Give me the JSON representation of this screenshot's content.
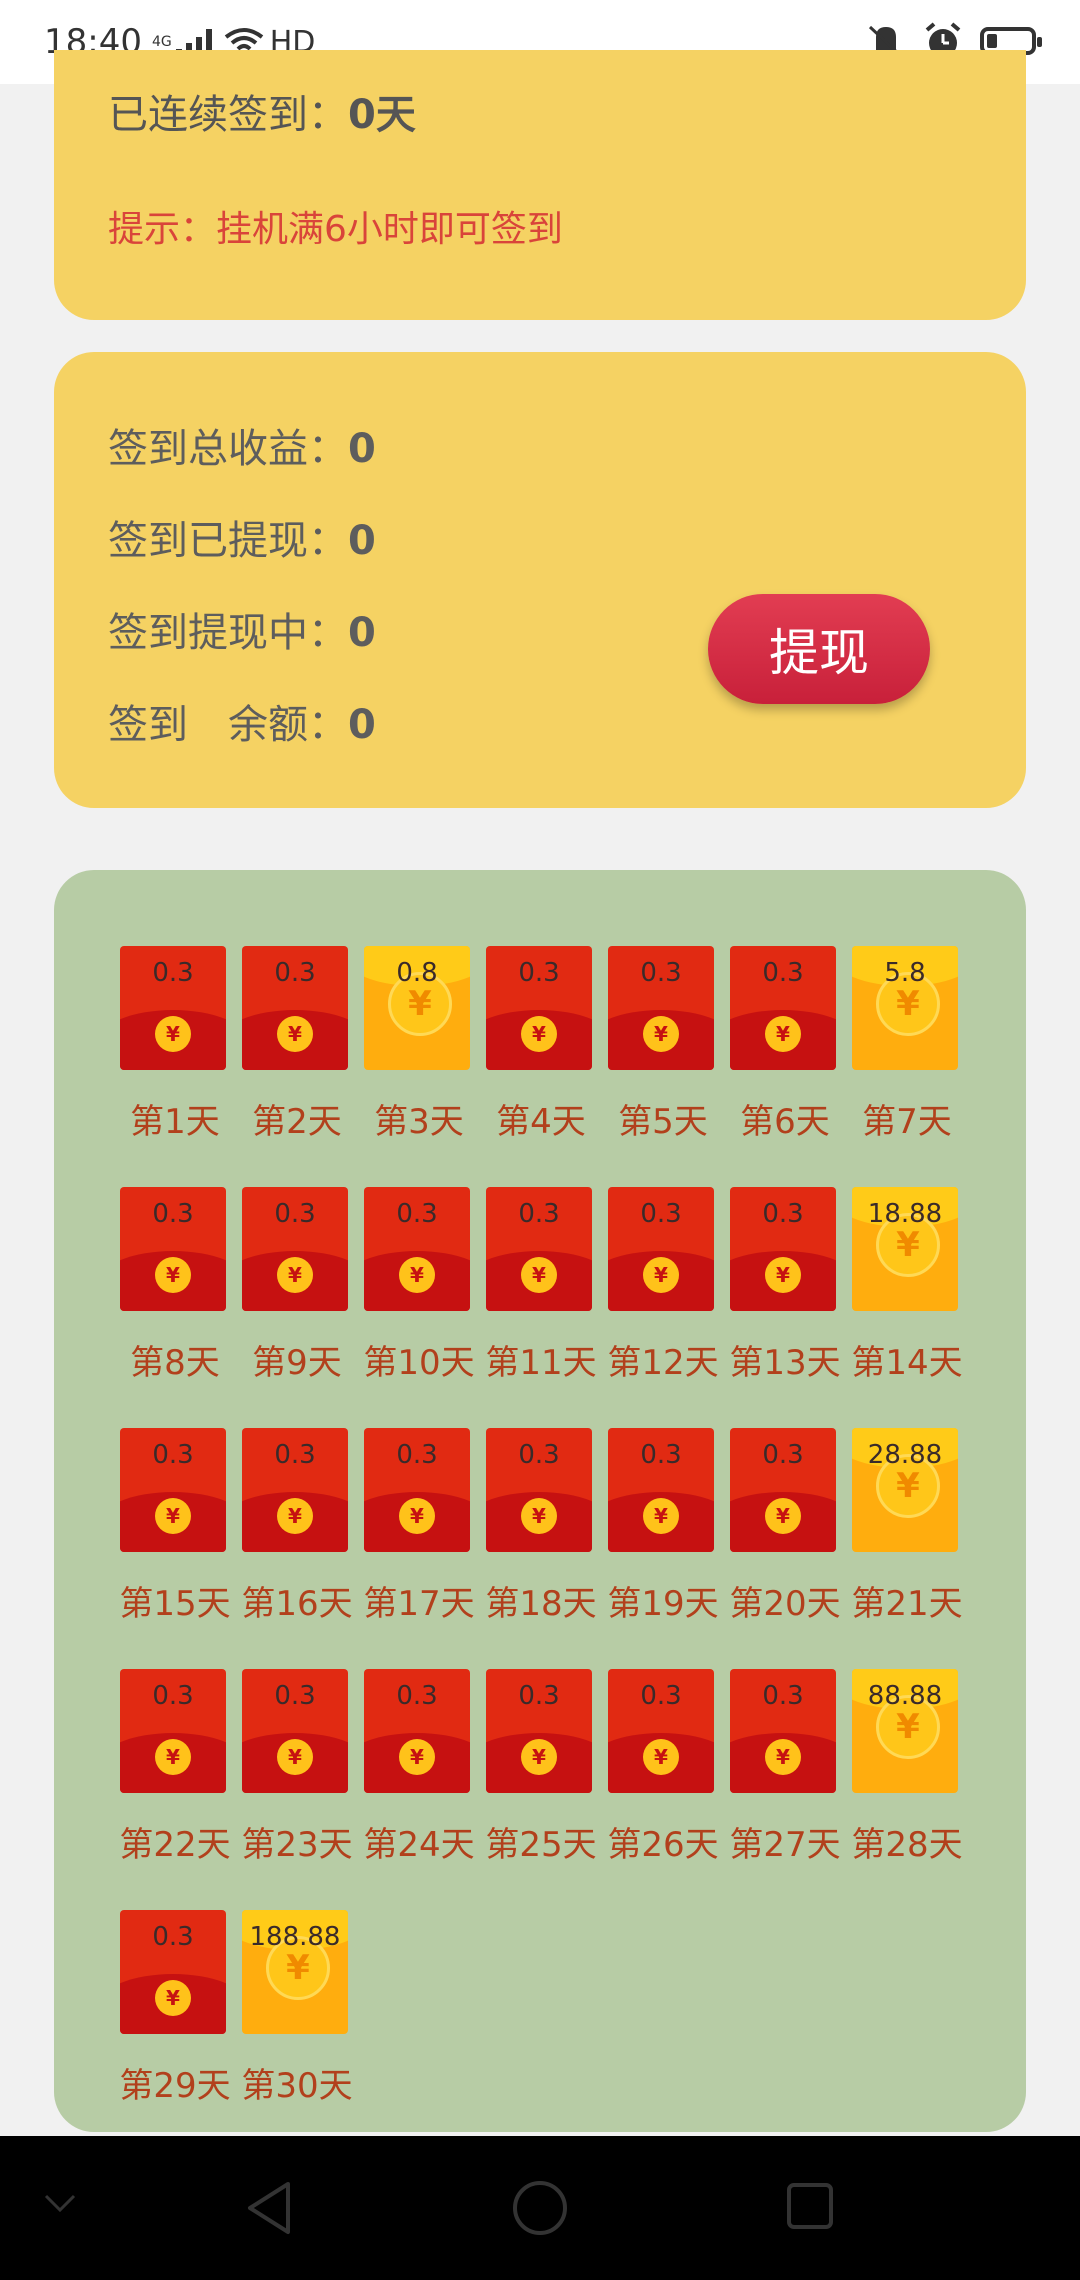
{
  "status_bar": {
    "time": "18:40",
    "network": "4G",
    "hd": "HD"
  },
  "checkin": {
    "streak_label": "已连续签到：",
    "streak_value": "0天",
    "tip": "提示：挂机满6小时即可签到"
  },
  "earnings": {
    "total_label": "签到总收益：",
    "total_value": "0",
    "withdrawn_label": "签到已提现：",
    "withdrawn_value": "0",
    "pending_label": "签到提现中：",
    "pending_value": "0",
    "balance_label": "签到　余额：",
    "balance_value": "0",
    "withdraw_button": "提现"
  },
  "days": [
    {
      "label": "第1天",
      "amount": "0.3",
      "type": "red"
    },
    {
      "label": "第2天",
      "amount": "0.3",
      "type": "red"
    },
    {
      "label": "第3天",
      "amount": "0.8",
      "type": "gold"
    },
    {
      "label": "第4天",
      "amount": "0.3",
      "type": "red"
    },
    {
      "label": "第5天",
      "amount": "0.3",
      "type": "red"
    },
    {
      "label": "第6天",
      "amount": "0.3",
      "type": "red"
    },
    {
      "label": "第7天",
      "amount": "5.8",
      "type": "gold"
    },
    {
      "label": "第8天",
      "amount": "0.3",
      "type": "red"
    },
    {
      "label": "第9天",
      "amount": "0.3",
      "type": "red"
    },
    {
      "label": "第10天",
      "amount": "0.3",
      "type": "red"
    },
    {
      "label": "第11天",
      "amount": "0.3",
      "type": "red"
    },
    {
      "label": "第12天",
      "amount": "0.3",
      "type": "red"
    },
    {
      "label": "第13天",
      "amount": "0.3",
      "type": "red"
    },
    {
      "label": "第14天",
      "amount": "18.88",
      "type": "gold"
    },
    {
      "label": "第15天",
      "amount": "0.3",
      "type": "red"
    },
    {
      "label": "第16天",
      "amount": "0.3",
      "type": "red"
    },
    {
      "label": "第17天",
      "amount": "0.3",
      "type": "red"
    },
    {
      "label": "第18天",
      "amount": "0.3",
      "type": "red"
    },
    {
      "label": "第19天",
      "amount": "0.3",
      "type": "red"
    },
    {
      "label": "第20天",
      "amount": "0.3",
      "type": "red"
    },
    {
      "label": "第21天",
      "amount": "28.88",
      "type": "gold"
    },
    {
      "label": "第22天",
      "amount": "0.3",
      "type": "red"
    },
    {
      "label": "第23天",
      "amount": "0.3",
      "type": "red"
    },
    {
      "label": "第24天",
      "amount": "0.3",
      "type": "red"
    },
    {
      "label": "第25天",
      "amount": "0.3",
      "type": "red"
    },
    {
      "label": "第26天",
      "amount": "0.3",
      "type": "red"
    },
    {
      "label": "第27天",
      "amount": "0.3",
      "type": "red"
    },
    {
      "label": "第28天",
      "amount": "88.88",
      "type": "gold"
    },
    {
      "label": "第29天",
      "amount": "0.3",
      "type": "red"
    },
    {
      "label": "第30天",
      "amount": "188.88",
      "type": "gold"
    }
  ],
  "icons": {
    "coin": "¥"
  },
  "colors": {
    "yellow_card": "#f5d263",
    "green_card": "#b7cca5",
    "withdraw_button": "#d92c45",
    "tip_text": "#d9443a",
    "day_label": "#b2401c"
  }
}
